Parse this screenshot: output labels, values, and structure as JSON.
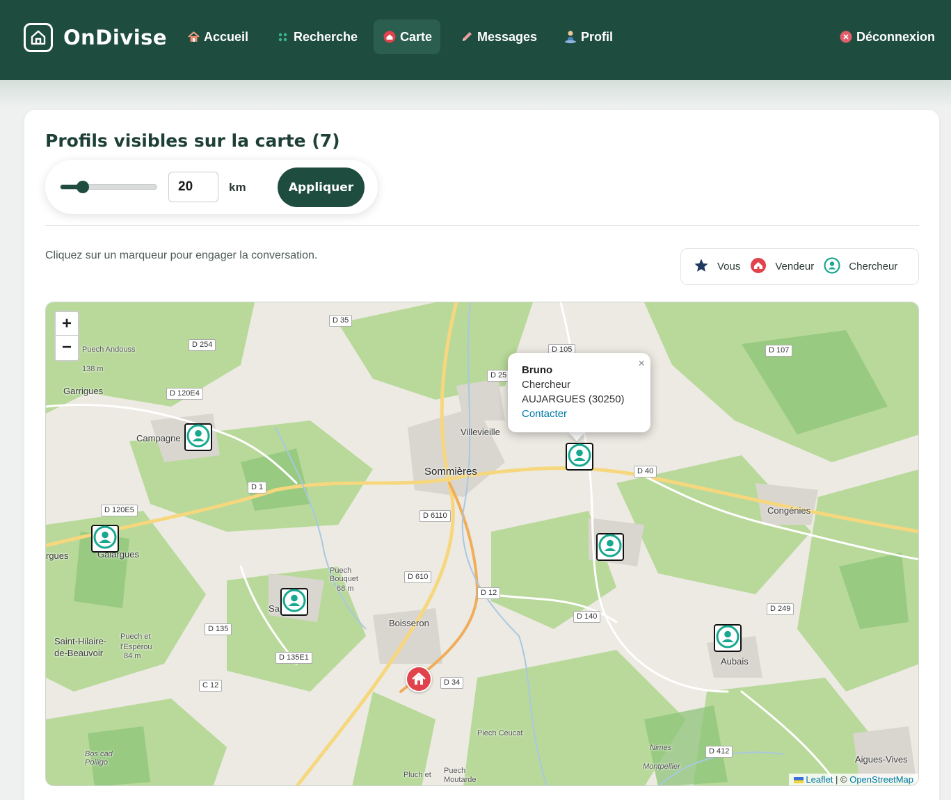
{
  "nav": {
    "brand": "OnDivise",
    "items": [
      {
        "label": "Accueil",
        "icon": "home-icon"
      },
      {
        "label": "Recherche",
        "icon": "search-dots-icon"
      },
      {
        "label": "Carte",
        "icon": "map-house-icon"
      },
      {
        "label": "Messages",
        "icon": "pencil-icon"
      },
      {
        "label": "Profil",
        "icon": "person-icon"
      }
    ],
    "logout": "Déconnexion",
    "active": "Carte",
    "colors": {
      "bg": "#1e4d3f",
      "active_bg": "#2c5e4f"
    }
  },
  "page": {
    "title": "Profils visibles sur la carte (7)",
    "hint": "Cliquez sur un marqueur pour engager la conversation."
  },
  "filter": {
    "radius_value": "20",
    "radius_unit": "km",
    "slider_fraction": 0.23,
    "apply_label": "Appliquer"
  },
  "legend": {
    "you": "Vous",
    "seller": "Vendeur",
    "seeker": "Chercheur",
    "colors": {
      "you": "#1e3a5f",
      "seller": "#e0434c",
      "seeker": "#17a88f"
    }
  },
  "map": {
    "zoom_in": "+",
    "zoom_out": "−",
    "places": {
      "puech_andouss": "Puech Andouss",
      "alt_138": "138 m",
      "garrigues": "Garrigues",
      "campagne": "Campagne",
      "villevieille": "Villevieille",
      "sommieres": "Sommières",
      "gallargues": "Galargues",
      "rgues": "rgues",
      "puech_bouquet": "Puech Bouquet",
      "alt_68": "68 m",
      "sa": "Sa",
      "boisseron": "Boisseron",
      "saint_hilaire": "Saint-Hilaire-de-Beauvoir",
      "puech_esperou": "Puech et l'Espérou",
      "alt_84": "84 m",
      "congenies": "Congénies",
      "aubais": "Aubais",
      "aigues_vives": "Aigues-Vives",
      "piech_ceucat": "Piech Ceucat",
      "bos_cad": "Bos cad Poiligo",
      "puech_moutarde": "Puech Moutarde",
      "pluch_et": "Pluch et",
      "nimes": "Nimes",
      "montpellier": "Montpellier"
    },
    "roads": {
      "d35": "D 35",
      "d254": "D 254",
      "d120e4": "D 120E4",
      "d105": "D 105",
      "d107": "D 107",
      "d25": "D 25",
      "d1": "D 1",
      "d120e5": "D 120E5",
      "d6110": "D 6110",
      "d40": "D 40",
      "d610": "D 610",
      "d12": "D 12",
      "d140": "D 140",
      "d249": "D 249",
      "d135": "D 135",
      "d135e1": "D 135E1",
      "c12": "C 12",
      "d34": "D 34",
      "d412": "D 412"
    },
    "popup": {
      "name": "Bruno",
      "role": "Chercheur",
      "location": "AUJARGUES (30250)",
      "action": "Contacter",
      "close": "×"
    },
    "attribution": {
      "leaflet": "Leaflet",
      "sep": " | © ",
      "osm": "OpenStreetMap"
    }
  }
}
